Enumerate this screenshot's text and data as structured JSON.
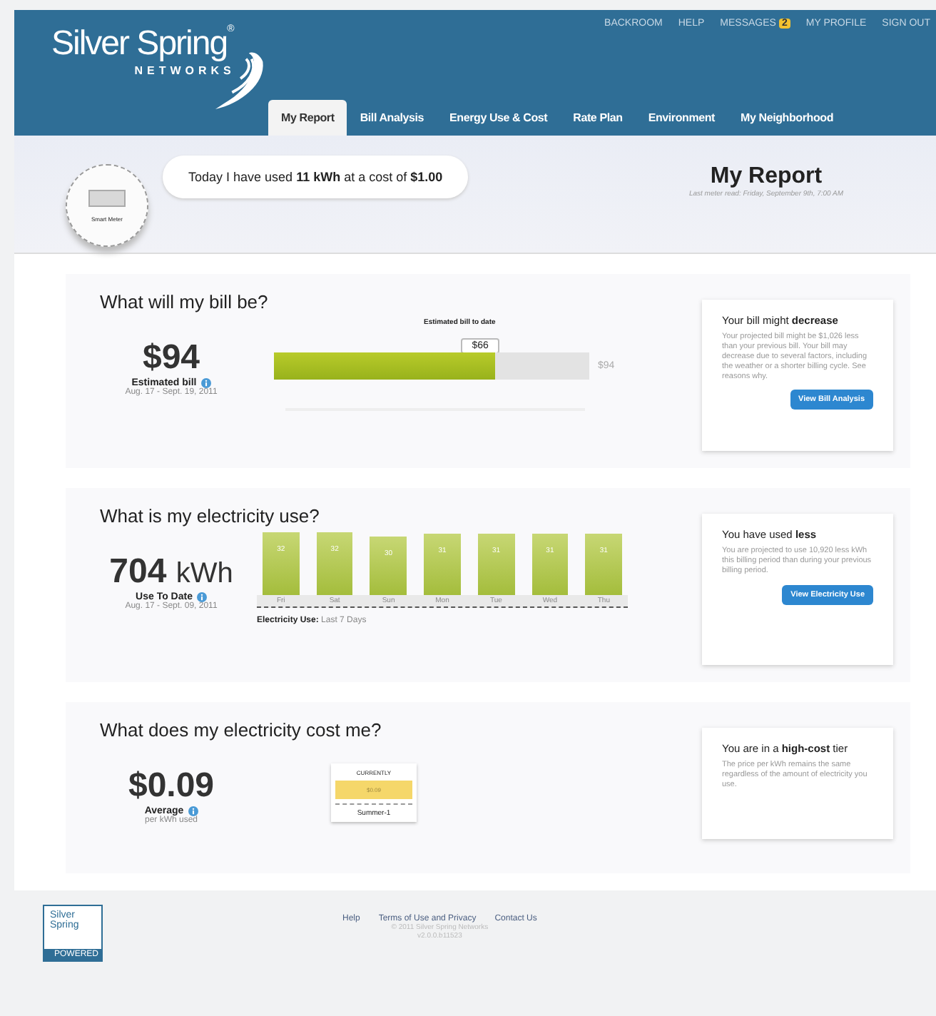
{
  "header": {
    "logo": {
      "name": "Silver Spring",
      "mark": "®",
      "sub": "NETWORKS"
    },
    "top_links": [
      {
        "label": "BACKROOM"
      },
      {
        "label": "HELP"
      },
      {
        "label": "MESSAGES",
        "badge": "2"
      },
      {
        "label": "MY PROFILE"
      },
      {
        "label": "SIGN OUT"
      }
    ],
    "tabs": [
      {
        "label": "My Report",
        "selected": true
      },
      {
        "label": "Bill Analysis",
        "selected": false
      },
      {
        "label": "Energy Use & Cost",
        "selected": false
      },
      {
        "label": "Rate Plan",
        "selected": false
      },
      {
        "label": "Environment",
        "selected": false
      },
      {
        "label": "My Neighborhood",
        "selected": false
      }
    ]
  },
  "summary": {
    "meter_label": "Smart Meter",
    "message": "Today I have used **11 kWh** at a cost of **$1.00**",
    "title": "My Report",
    "last_read": "Last meter read: Friday, September 9th, 7:00 AM"
  },
  "bill": {
    "heading": "What will my bill be?",
    "amount": "$94",
    "label": "Estimated bill",
    "dates": "Aug. 17 - Sept. 19, 2011",
    "bar_caption": "Estimated bill to date",
    "bar_value": "$66",
    "level": 0.7,
    "bar_end": "$94",
    "tip": {
      "title": "Your bill might **decrease**",
      "text": "Your projected bill might be $1,026 less than your previous bill. Your bill may decrease due to several factors, including the weather or a shorter billing cycle. See reasons why.",
      "button": "View Bill Analysis"
    }
  },
  "usage": {
    "heading": "What is my electricity use?",
    "amount": "704",
    "unit": "kWh",
    "label": "Use To Date",
    "dates": "Aug. 17 - Sept. 09, 2011",
    "chart_data": {
      "type": "bar",
      "categories": [
        "Fri",
        "Sat",
        "Sun",
        "Mon",
        "Tue",
        "Wed",
        "Thu"
      ],
      "values": [
        32,
        32,
        30,
        31,
        31,
        31,
        31
      ],
      "data_labels": true
    },
    "caption": "**Electricity Use:** Last 7 Days",
    "tip": {
      "title": "You have used **less**",
      "text": "You are projected to use 10,920 less kWh this billing period than during your previous billing period.",
      "button": "View Electricity Use"
    }
  },
  "cost": {
    "heading": "What does my electricity cost me?",
    "amount": "$0.09",
    "label": "Average",
    "sublabel": "per kWh used",
    "tier": {
      "caption": "CURRENTLY",
      "price": "$0.09",
      "selected": true,
      "name": "Summer-1"
    },
    "tip": {
      "title": "You are in a **high-cost** tier",
      "text": "The price per kWh remains the same regardless of the amount of electricity you use."
    }
  },
  "footer": {
    "logo": {
      "name": "Silver Spring",
      "sub": "POWERED"
    },
    "links": [
      {
        "label": "Help"
      },
      {
        "label": "Terms of Use and Privacy"
      },
      {
        "label": "Contact Us"
      }
    ],
    "copyright": "© 2011 Silver Spring Networks",
    "version": "v2.0.0.b11523"
  }
}
